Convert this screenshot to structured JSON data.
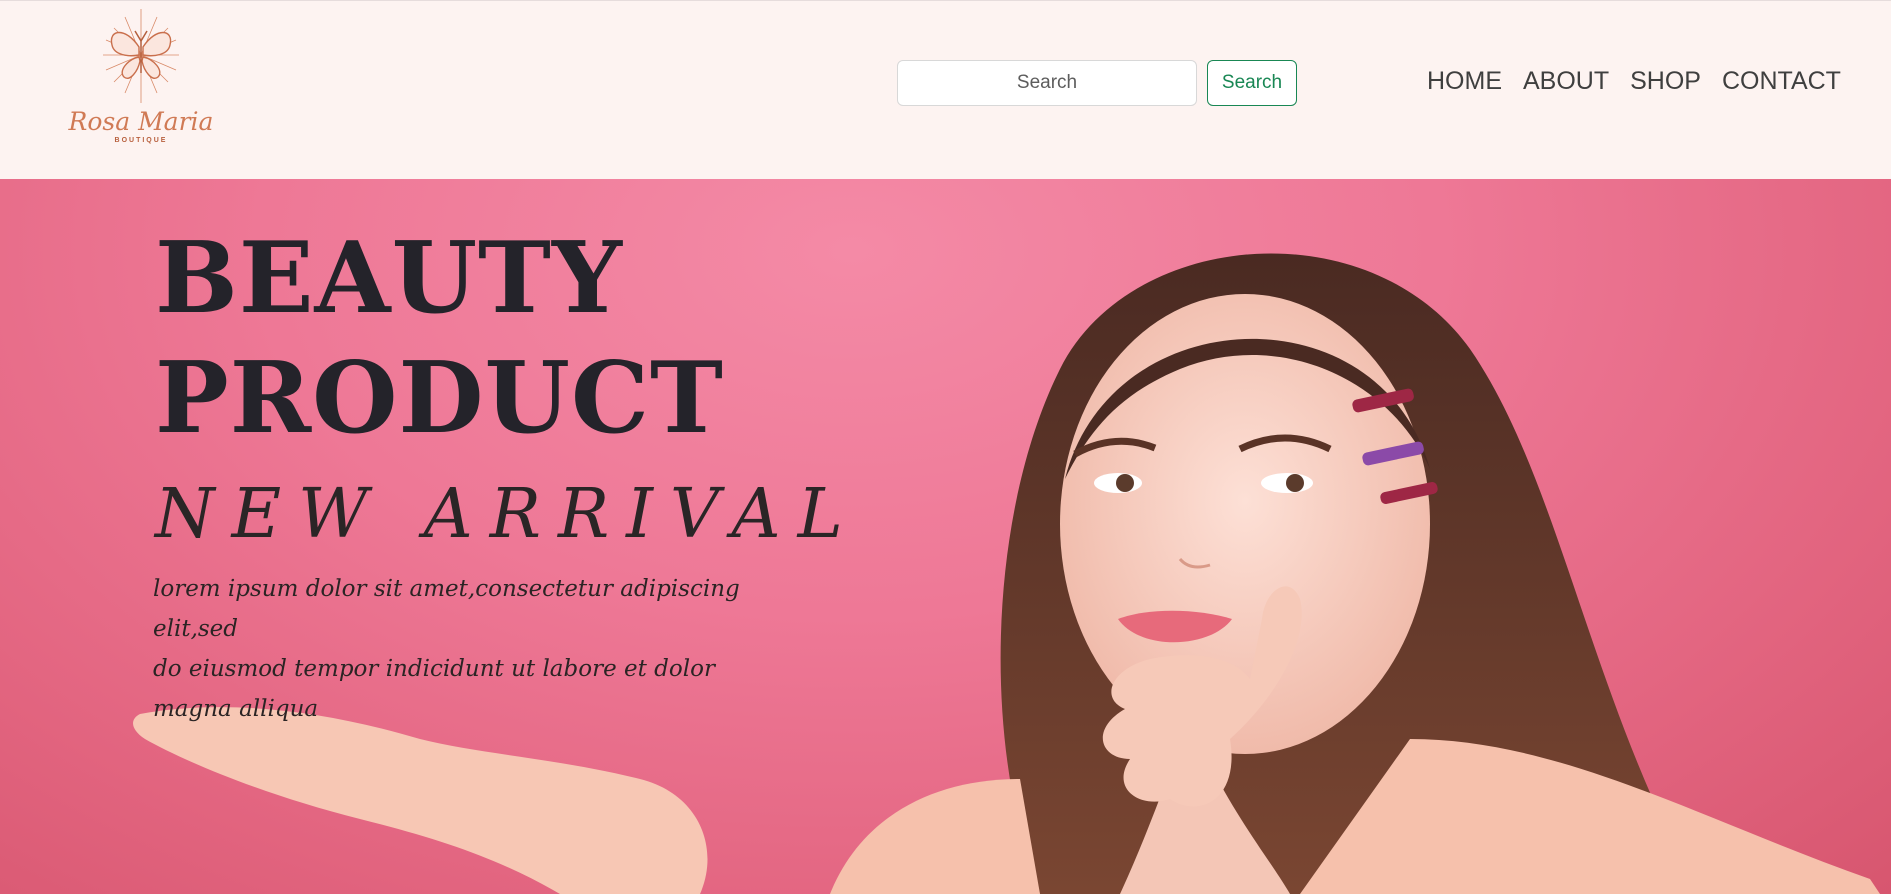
{
  "brand": {
    "name": "Rosa Maria",
    "tagline": "BOUTIQUE",
    "accent_color": "#d07a55",
    "icon": "butterfly-icon"
  },
  "search": {
    "placeholder": "Search",
    "button_label": "Search",
    "button_color": "#198754"
  },
  "nav": {
    "items": [
      {
        "label": "HOME"
      },
      {
        "label": "ABOUT"
      },
      {
        "label": "SHOP"
      },
      {
        "label": "CONTACT"
      }
    ]
  },
  "hero": {
    "title_line1": "BEAUTY",
    "title_line2": "PRODUCT",
    "subtitle": "NEW ARRIVAL",
    "text_line1": "lorem ipsum dolor sit amet,consectetur adipiscing elit,sed",
    "text_line2": "do eiusmod tempor indicidunt ut labore et dolor magna alliqua",
    "background_color": "#ee7896",
    "image": "model-photo"
  }
}
